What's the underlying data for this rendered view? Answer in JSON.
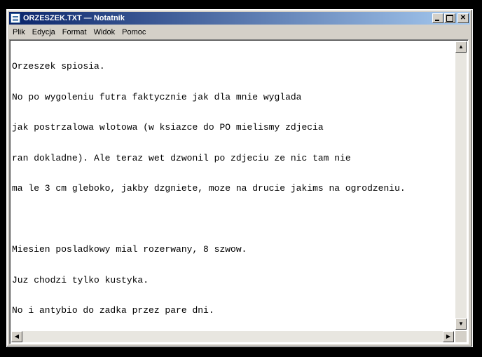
{
  "window": {
    "title": "ORZESZEK.TXT — Notatnik"
  },
  "menu": {
    "items": [
      "Plik",
      "Edycja",
      "Format",
      "Widok",
      "Pomoc"
    ]
  },
  "editor": {
    "lines": [
      "Orzeszek spiosia.",
      "No po wygoleniu futra faktycznie jak dla mnie wyglada",
      "jak postrzalowa wlotowa (w ksiazce do PO mielismy zdjecia",
      "ran dokladne). Ale teraz wet dzwonil po zdjeciu ze nic tam nie",
      "ma le 3 cm gleboko, jakby dzgniete, moze na drucie jakims na ogrodzeniu.",
      "",
      "Miesien posladkowy mial rozerwany, 8 szwow.",
      "Juz chodzi tylko kustyka.",
      "No i antybio do zadka przez pare dni."
    ]
  },
  "glyphs": {
    "up": "▲",
    "down": "▼",
    "left": "◀",
    "right": "▶",
    "close": "✕"
  }
}
